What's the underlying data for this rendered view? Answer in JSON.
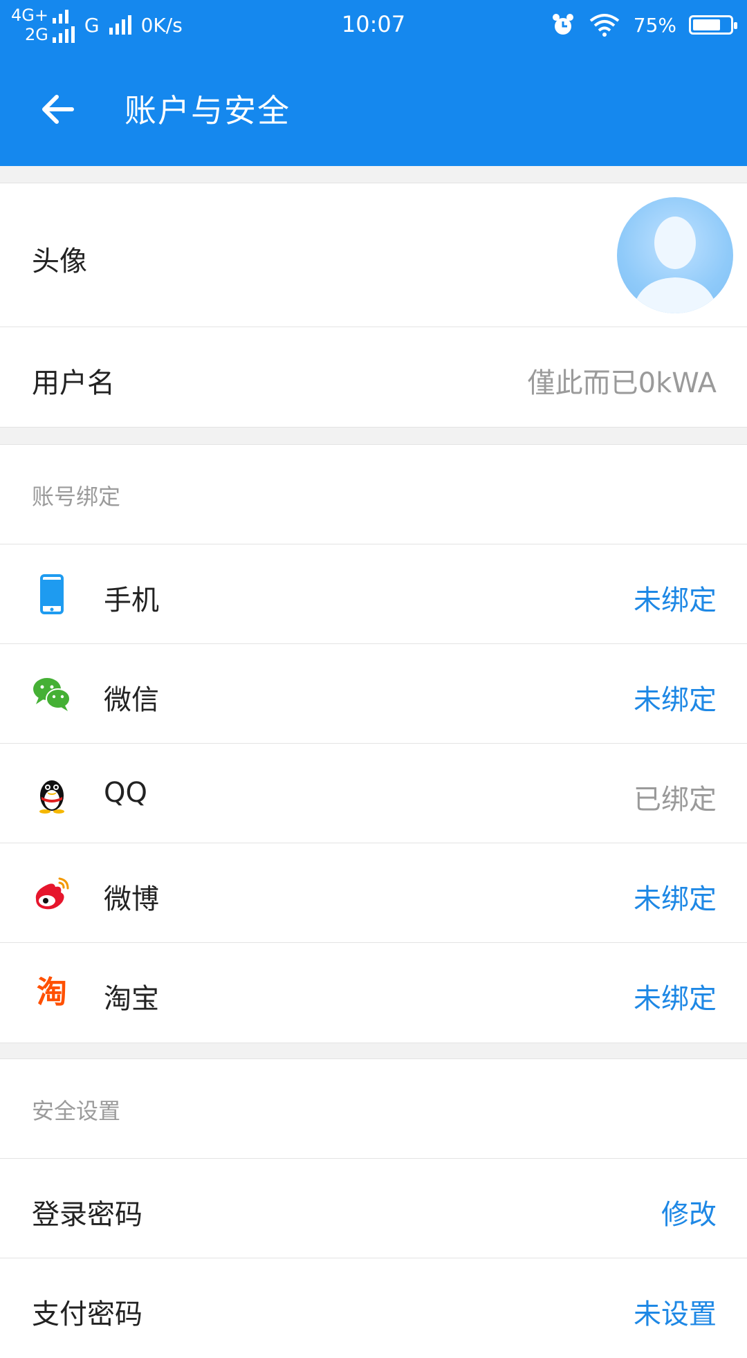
{
  "status_bar": {
    "net_top": "4G+",
    "net_bottom": "2G",
    "net_extra": "G",
    "speed": "0K/s",
    "time": "10:07",
    "battery_text": "75%",
    "battery_level": 0.75,
    "icons": [
      "alarm-icon",
      "wifi-icon",
      "battery-icon"
    ]
  },
  "app_bar": {
    "title": "账户与安全",
    "back_icon": "arrow-left-icon"
  },
  "profile": {
    "avatar_label": "头像",
    "username_label": "用户名",
    "username_value": "僅此而已0kWA"
  },
  "bindings": {
    "section_title": "账号绑定",
    "items": [
      {
        "label": "手机",
        "status": "未绑定",
        "icon": "phone-icon"
      },
      {
        "label": "微信",
        "status": "未绑定",
        "icon": "wechat-icon"
      },
      {
        "label": "QQ",
        "status": "已绑定",
        "icon": "qq-icon"
      },
      {
        "label": "微博",
        "status": "未绑定",
        "icon": "weibo-icon"
      },
      {
        "label": "淘宝",
        "status": "未绑定",
        "icon": "taobao-icon"
      }
    ]
  },
  "security": {
    "section_title": "安全设置",
    "items": [
      {
        "label": "登录密码",
        "action": "修改"
      },
      {
        "label": "支付密码",
        "action": "未设置"
      }
    ]
  },
  "colors": {
    "primary": "#1588ee",
    "link": "#1e88e5",
    "muted": "#9a9a9a",
    "wechat": "#45b035",
    "weibo": "#e6162d",
    "taobao": "#ff5000"
  }
}
